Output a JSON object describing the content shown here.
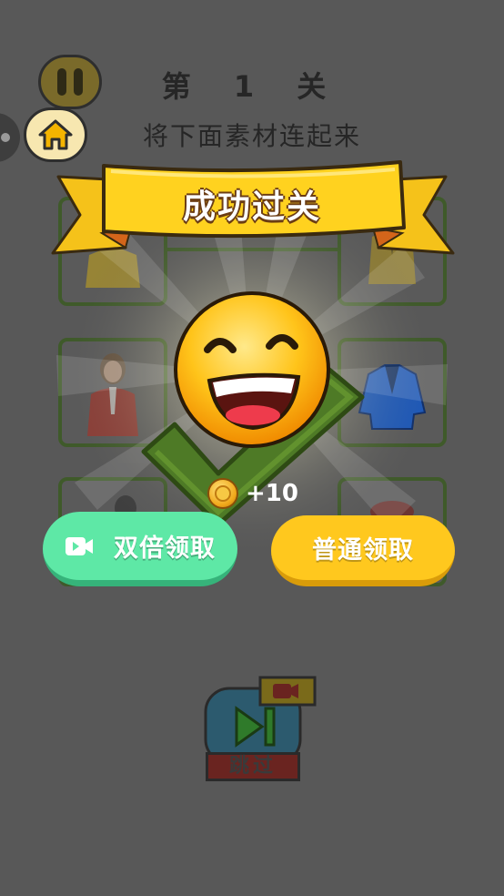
{
  "level": {
    "title": "第 1 关",
    "instruction": "将下面素材连起来"
  },
  "modal": {
    "banner_text": "成功过关",
    "reward_amount": "+10",
    "double_button_label": "双倍领取",
    "normal_button_label": "普通领取"
  },
  "skip": {
    "label": "跳过"
  },
  "colors": {
    "accent_yellow": "#ffc81e",
    "accent_green": "#5ee8a6",
    "banner_yellow": "#ffd21f",
    "card_border": "#3f5a2a"
  },
  "icons": {
    "pause": "pause-icon",
    "home": "home-icon",
    "video": "video-icon",
    "coin": "coin-icon",
    "skip": "skip-icon"
  }
}
